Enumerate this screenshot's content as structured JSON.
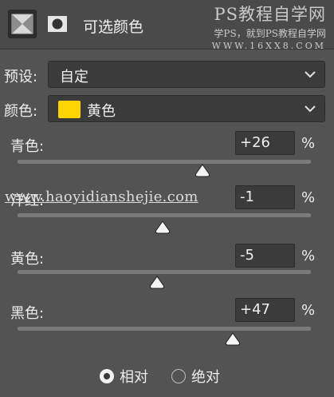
{
  "header": {
    "title": "可选颜色",
    "watermark_line1": "PS教程自学网",
    "watermark_line2": "学PS，就到PS教程自学网",
    "watermark_line3": "WWW.16XX8.COM"
  },
  "preset": {
    "label": "预设:",
    "value": "自定"
  },
  "colors": {
    "label": "颜色:",
    "value": "黄色",
    "swatch_color": "#ffd400"
  },
  "sliders": [
    {
      "label": "青色:",
      "value": "+26",
      "unit": "%",
      "percent": 26
    },
    {
      "label": "洋红:",
      "value": "-1",
      "unit": "%",
      "percent": -1
    },
    {
      "label": "黄色:",
      "value": "-5",
      "unit": "%",
      "percent": -5
    },
    {
      "label": "黑色:",
      "value": "+47",
      "unit": "%",
      "percent": 47
    }
  ],
  "watermark_mid": "www.haoyidianshejie.com",
  "method": {
    "relative_label": "相对",
    "absolute_label": "绝对",
    "selected": "relative"
  }
}
